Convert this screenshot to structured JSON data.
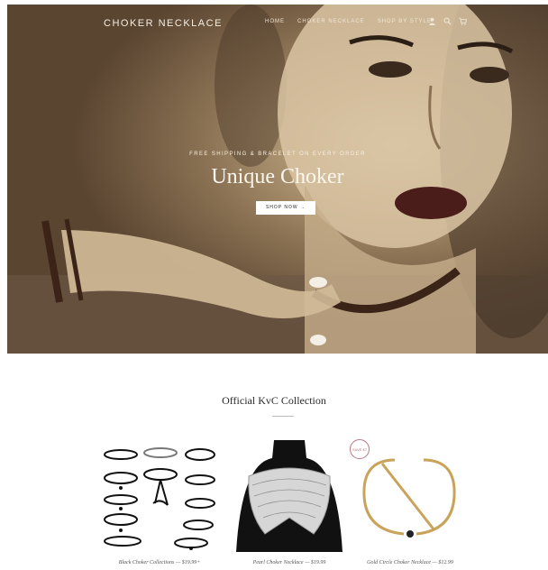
{
  "header": {
    "logo": "CHOKER NECKLACE",
    "nav_links": [
      "HOME",
      "CHOKER NECKLACE",
      "SHOP BY STYLE"
    ],
    "icons": [
      "user-icon",
      "search-icon",
      "cart-icon"
    ]
  },
  "hero": {
    "subtitle": "FREE SHIPPING & BRACELET ON EVERY ORDER",
    "title": "Unique Choker",
    "button_label": "SHOP NOW →"
  },
  "collection": {
    "title": "Official KvC Collection",
    "products": [
      {
        "caption": "Black Choker Collections — $19.99+"
      },
      {
        "caption": "Pearl Choker Necklace — $19.99"
      },
      {
        "caption": "Gold Circle Choker Necklace — $12.99",
        "badge": "SAVE $7"
      }
    ]
  },
  "colors": {
    "sepia_light": "#d8c8ad",
    "sepia_dark": "#5a4531",
    "badge_accent": "#b5787f"
  }
}
